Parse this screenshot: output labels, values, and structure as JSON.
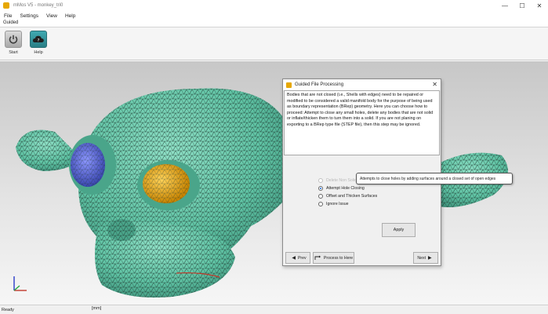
{
  "window": {
    "title": "mMos V5 - monkey_tri0",
    "icon": "app-logo-icon",
    "controls": {
      "minimize": "—",
      "maximize": "☐",
      "close": "✕"
    }
  },
  "menu": [
    "File",
    "Settings",
    "View",
    "Help"
  ],
  "ribbon": {
    "tab": "Guided",
    "buttons": [
      {
        "label": "Start",
        "icon": "power-icon"
      },
      {
        "label": "Help",
        "icon": "cloud-help-icon"
      }
    ]
  },
  "dialog": {
    "title": "Guided File Processing",
    "close": "✕",
    "description": "Bodies that are not closed (i.e., Shells with edges) need to be repaired or modified to be considered a valid manifold body for the purpose of being used as boundary representation (BRep) geometry. Here you can choose how to proceed: Attempt to close any small holes, delete any bodies that are not solid or inflate/thicken them to turn them into a solid. If you are not planing on exporting to a BRep type file (STEP file), then this step may be ignored.",
    "options": [
      {
        "label": "Delete Non Solid",
        "checked": false,
        "disabled": true
      },
      {
        "label": "Attempt Hole Closing",
        "checked": true,
        "disabled": false
      },
      {
        "label": "Offset and Thicken Surfaces",
        "checked": false,
        "disabled": false
      },
      {
        "label": "Ignore Issue",
        "checked": false,
        "disabled": false
      }
    ],
    "apply": "Apply",
    "prev": "Prev",
    "process": "Process to Here",
    "next": "Next"
  },
  "tooltip": "Attempts to close holes by adding surfaces around a closed set of open edges",
  "status": {
    "text": "Ready",
    "units": "[mm]"
  },
  "colors": {
    "mesh": "#5fc3a4",
    "eye_left": "#4a57c4",
    "eye_right": "#e0a21a",
    "wire": "#1f3a30"
  }
}
